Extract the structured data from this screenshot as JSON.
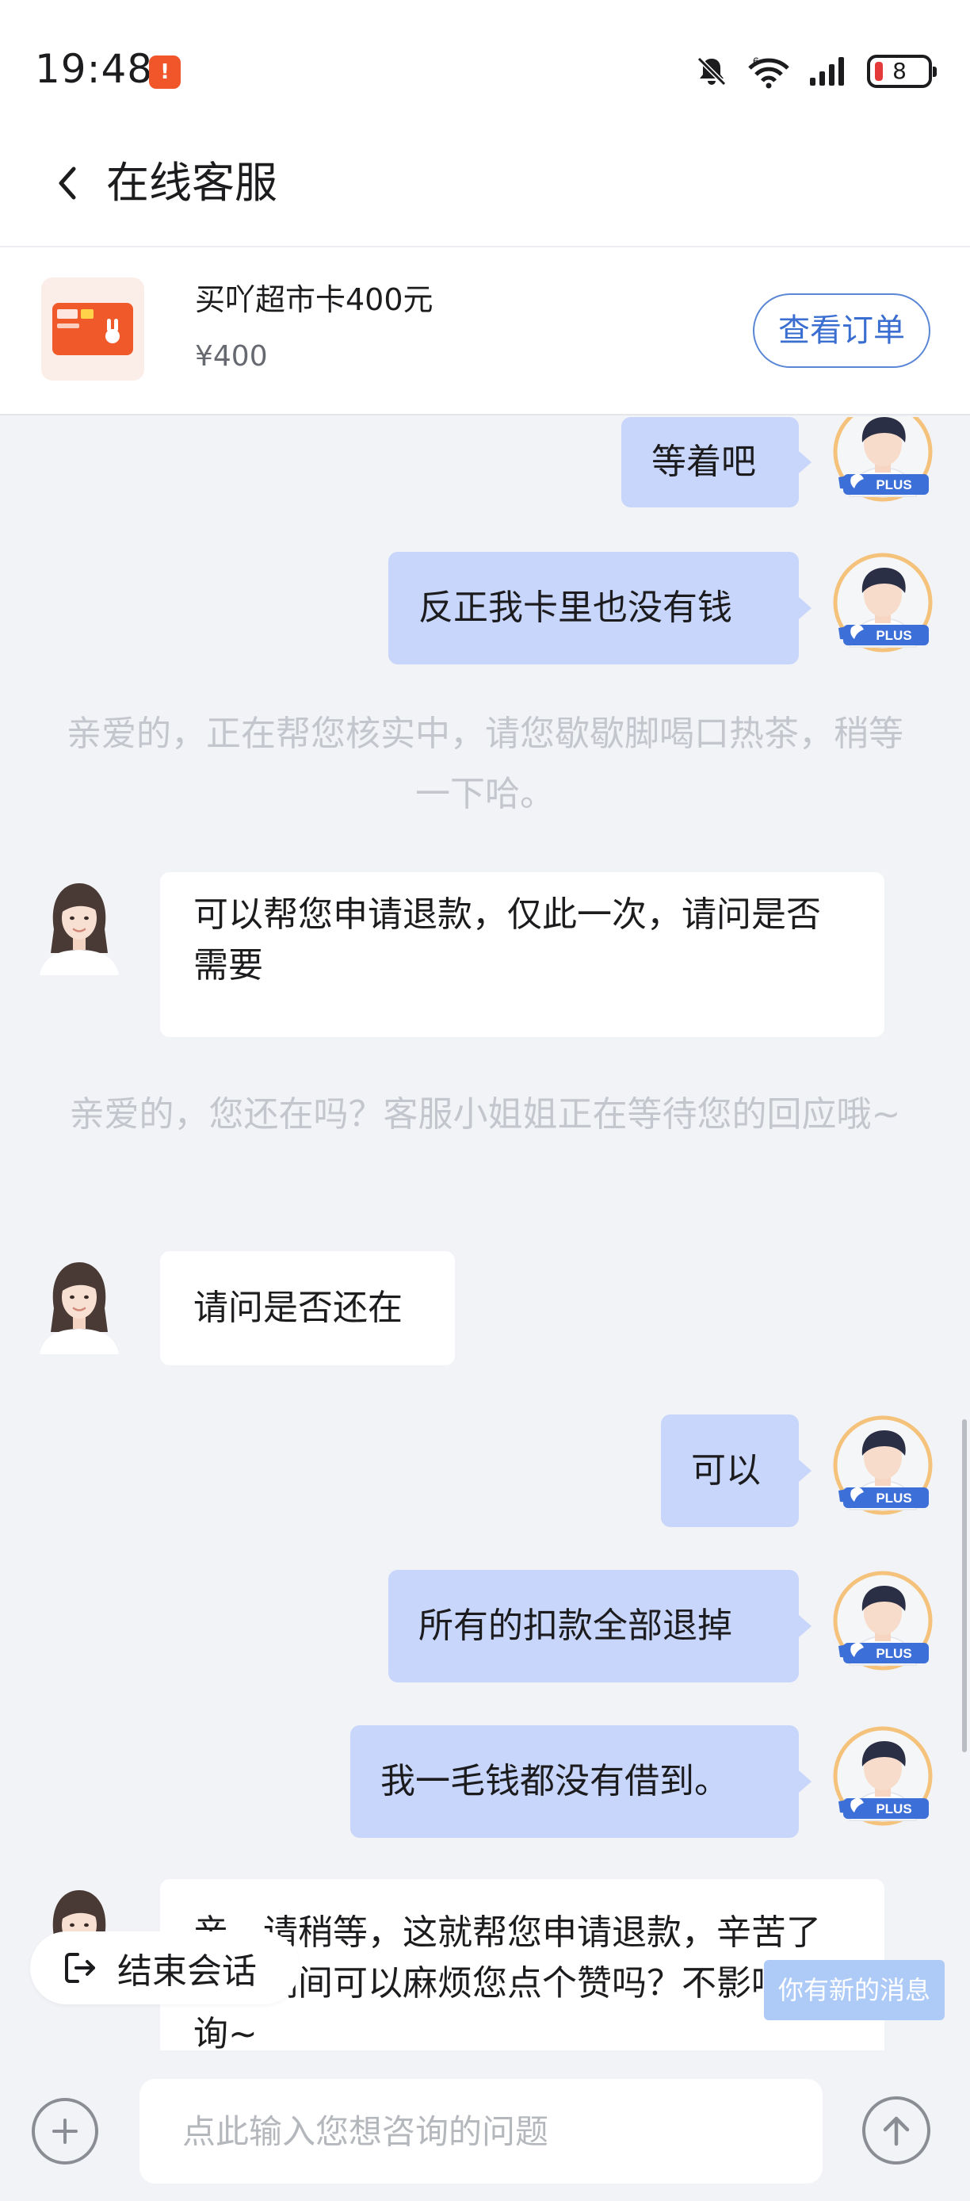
{
  "status_bar": {
    "time": "19:48",
    "notification_badge": "!",
    "battery": "8",
    "icons": [
      "mute-icon",
      "wifi-icon",
      "signal-icon",
      "battery-icon"
    ]
  },
  "header": {
    "back_icon": "chevron-left-icon",
    "title": "在线客服"
  },
  "order": {
    "product_name": "买吖超市卡400元",
    "price": "¥400",
    "view_order_label": "查看订单"
  },
  "messages": [
    {
      "type": "user",
      "text": "等着吧"
    },
    {
      "type": "user",
      "text": "反正我卡里也没有钱"
    },
    {
      "type": "system",
      "text": "亲爱的，正在帮您核实中，请您歇歇脚喝口热茶，稍等一下哈。"
    },
    {
      "type": "agent",
      "text": "可以帮您申请退款，仅此一次，请问是否需要"
    },
    {
      "type": "system",
      "text": "亲爱的，您还在吗？客服小姐姐正在等待您的回应哦~"
    },
    {
      "type": "agent",
      "text": "请问是否还在"
    },
    {
      "type": "user",
      "text": "可以"
    },
    {
      "type": "user",
      "text": "所有的扣款全部退掉"
    },
    {
      "type": "user",
      "text": "我一毛钱都没有借到。"
    },
    {
      "type": "agent",
      "text": "亲，请稍等，这就帮您申请退款，辛苦了呢！期间可以麻烦您点个赞吗？不影响咨询~"
    }
  ],
  "user_badge": "PLUS",
  "controls": {
    "end_chat_label": "结束会话",
    "new_message_toast": "你有新的消息",
    "input_placeholder": "点此输入您想咨询的问题"
  },
  "colors": {
    "user_bubble": "#c8d6fb",
    "agent_bubble": "#ffffff",
    "background": "#f2f3f7",
    "accent_blue": "#3a6ed0",
    "product_orange": "#f05a2b"
  }
}
